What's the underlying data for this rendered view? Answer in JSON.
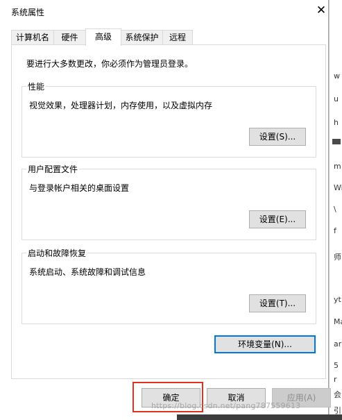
{
  "window": {
    "title": "系统属性",
    "close_glyph": "✕"
  },
  "tabs": [
    {
      "label": "计算机名"
    },
    {
      "label": "硬件"
    },
    {
      "label": "高级"
    },
    {
      "label": "系统保护"
    },
    {
      "label": "远程"
    }
  ],
  "active_tab": "高级",
  "admin_note": "要进行大多数更改，你必须作为管理员登录。",
  "groups": {
    "performance": {
      "title": "性能",
      "description": "视觉效果，处理器计划，内存使用，以及虚拟内存",
      "button": "设置(S)..."
    },
    "user_profiles": {
      "title": "用户配置文件",
      "description": "与登录帐户相关的桌面设置",
      "button": "设置(E)..."
    },
    "startup_recovery": {
      "title": "启动和故障恢复",
      "description": "系统启动、系统故障和调试信息",
      "button": "设置(T)..."
    }
  },
  "env_button": "环境变量(N)...",
  "footer": {
    "ok": "确定",
    "cancel": "取消",
    "apply": "应用(A)"
  },
  "watermark": "https://blog.csdn.net/pang787559613",
  "background_chars": [
    "w",
    "u",
    "h",
    "m",
    "Wi",
    "\\",
    "f",
    "师",
    "yt",
    "Ma",
    "ar",
    "5",
    "r",
    "会",
    "引"
  ],
  "colors": {
    "accent": "#0078d7",
    "highlight": "#e0301e",
    "button_bg": "#e1e1e1"
  }
}
